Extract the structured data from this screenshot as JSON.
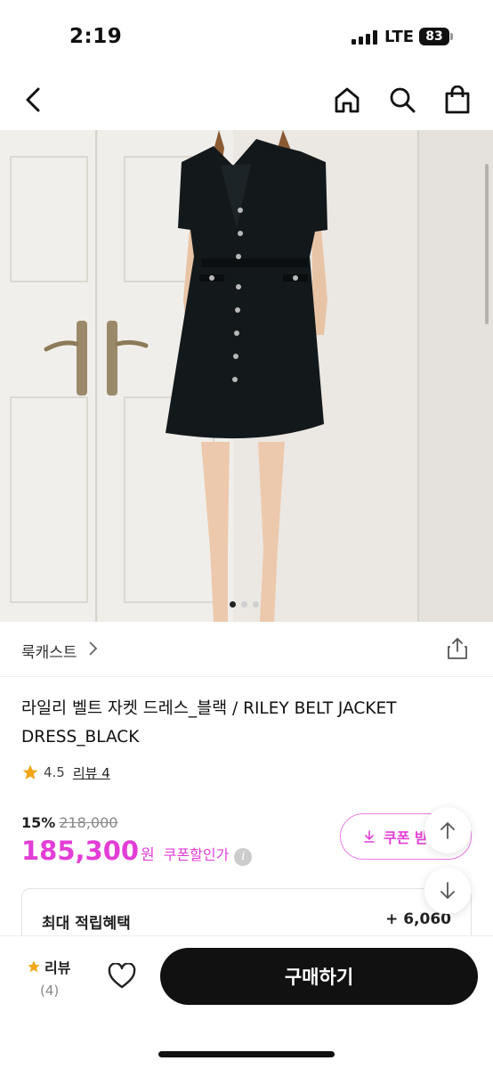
{
  "status": {
    "time": "2:19",
    "network": "LTE",
    "battery": "83"
  },
  "nav": {
    "back": "back-icon",
    "home": "home-icon",
    "search": "search-icon",
    "cart": "shopping-bag-icon"
  },
  "carousel": {
    "current": 1,
    "total": 3
  },
  "brand": {
    "name": "룩캐스트"
  },
  "product": {
    "title": "라일리 벨트 자켓 드레스_블랙 / RILEY BELT JACKET DRESS_BLACK",
    "rating": "4.5",
    "review_label": "리뷰 4"
  },
  "price": {
    "discount_rate": "15%",
    "original": "218,000",
    "sale": "185,300",
    "currency": "원",
    "coupon_price_label": "쿠폰할인가",
    "coupon_button": "쿠폰 받"
  },
  "reward": {
    "label": "최대 적립혜택",
    "value": "+ 6,060"
  },
  "bottom": {
    "review_label": "리뷰",
    "review_count": "(4)",
    "buy_label": "구매하기"
  },
  "colors": {
    "accent": "#e23ed6",
    "star": "#f2a516",
    "primary": "#111111"
  }
}
